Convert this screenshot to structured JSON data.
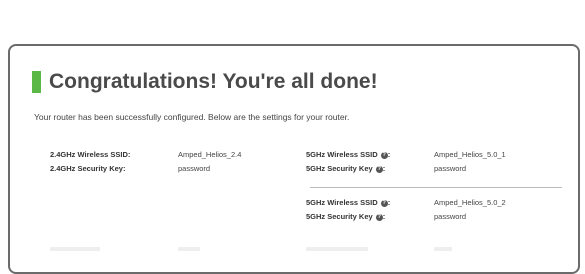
{
  "colors": {
    "accent": "#5bb847",
    "border": "#6b6b6b"
  },
  "header": {
    "title": "Congratulations! You're all done!",
    "subtitle": "Your router has been successfully configured. Below are the settings for your router."
  },
  "settings": {
    "ssid_24_label": "2.4GHz Wireless SSID:",
    "ssid_24_value": "Amped_Helios_2.4",
    "key_24_label": "2.4GHz Security Key:",
    "key_24_value": "password",
    "ssid_5_1_label": "5GHz Wireless SSID",
    "ssid_5_1_value": "Amped_Helios_5.0_1",
    "key_5_1_label": "5GHz Security Key",
    "key_5_1_value": "password",
    "ssid_5_2_label": "5GHz Wireless SSID",
    "ssid_5_2_value": "Amped_Helios_5.0_2",
    "key_5_2_label": "5GHz Security Key",
    "key_5_2_value": "password",
    "info_glyph": "?",
    "colon": ":"
  }
}
